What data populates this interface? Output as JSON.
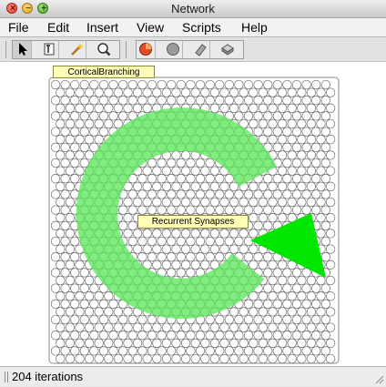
{
  "window": {
    "title": "Network"
  },
  "menu": [
    "File",
    "Edit",
    "Insert",
    "View",
    "Scripts",
    "Help"
  ],
  "toolbar": {
    "groups": [
      [
        "select-arrow-icon",
        "edit-text-icon",
        "wand-icon",
        "zoom-search-icon"
      ],
      [
        "clear-neurons-icon",
        "neuron-grey-icon",
        "eraser-icon",
        "randomize-icon"
      ]
    ]
  },
  "network": {
    "group_label": "CorticalBranching",
    "synapse_label": "Recurrent Synapses",
    "arrow_color": "#5ee85e",
    "arrowhead_color": "#00e600",
    "neuron_stroke": "#6e6e6e"
  },
  "status": {
    "text": "204 iterations"
  }
}
